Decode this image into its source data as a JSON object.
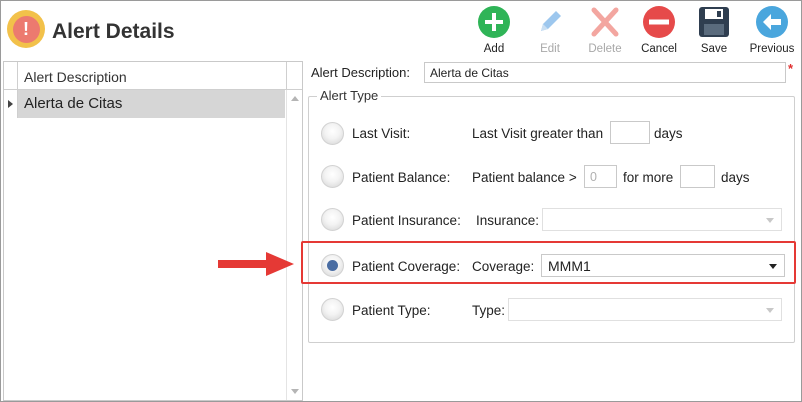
{
  "window": {
    "title": "Alert Details",
    "app_icon": "alert-exclamation-icon"
  },
  "toolbar": [
    {
      "label": "Add",
      "icon": "add-plus-icon",
      "color": "#2fb457",
      "enabled": true
    },
    {
      "label": "Edit",
      "icon": "edit-pencil-icon",
      "color": "#9dc7ee",
      "enabled": false
    },
    {
      "label": "Delete",
      "icon": "delete-x-icon",
      "color": "#f3a6a0",
      "enabled": false
    },
    {
      "label": "Cancel",
      "icon": "cancel-minus-icon",
      "color": "#e64a4a",
      "enabled": true
    },
    {
      "label": "Save",
      "icon": "save-floppy-icon",
      "color": "#2f3e50",
      "enabled": true
    },
    {
      "label": "Previous",
      "icon": "previous-arrow-icon",
      "color": "#4aa6dd",
      "enabled": true
    }
  ],
  "list": {
    "column_header": "Alert Description",
    "rows": [
      {
        "description": "Alerta de Citas",
        "selected": true
      }
    ]
  },
  "form": {
    "description_label": "Alert Description:",
    "description_value": "Alerta de Citas",
    "required_marker": "*",
    "alert_type_legend": "Alert Type",
    "options": {
      "last_visit": {
        "label": "Last Visit:",
        "text_before": "Last Visit greater than",
        "value": "",
        "text_after": "days",
        "checked": false
      },
      "patient_balance": {
        "label": "Patient Balance:",
        "text_before": "Patient balance >",
        "amount_placeholder": "0",
        "text_middle": "for more",
        "days_value": "",
        "text_after": "days",
        "checked": false
      },
      "patient_insurance": {
        "label": "Patient Insurance:",
        "field_label": "Insurance:",
        "selected": "",
        "checked": false
      },
      "patient_coverage": {
        "label": "Patient Coverage:",
        "field_label": "Coverage:",
        "selected": "MMM1",
        "checked": true
      },
      "patient_type": {
        "label": "Patient Type:",
        "field_label": "Type:",
        "selected": "",
        "checked": false
      }
    }
  },
  "annotation": {
    "highlight_color": "#e53935",
    "arrow_color": "#e53935"
  }
}
